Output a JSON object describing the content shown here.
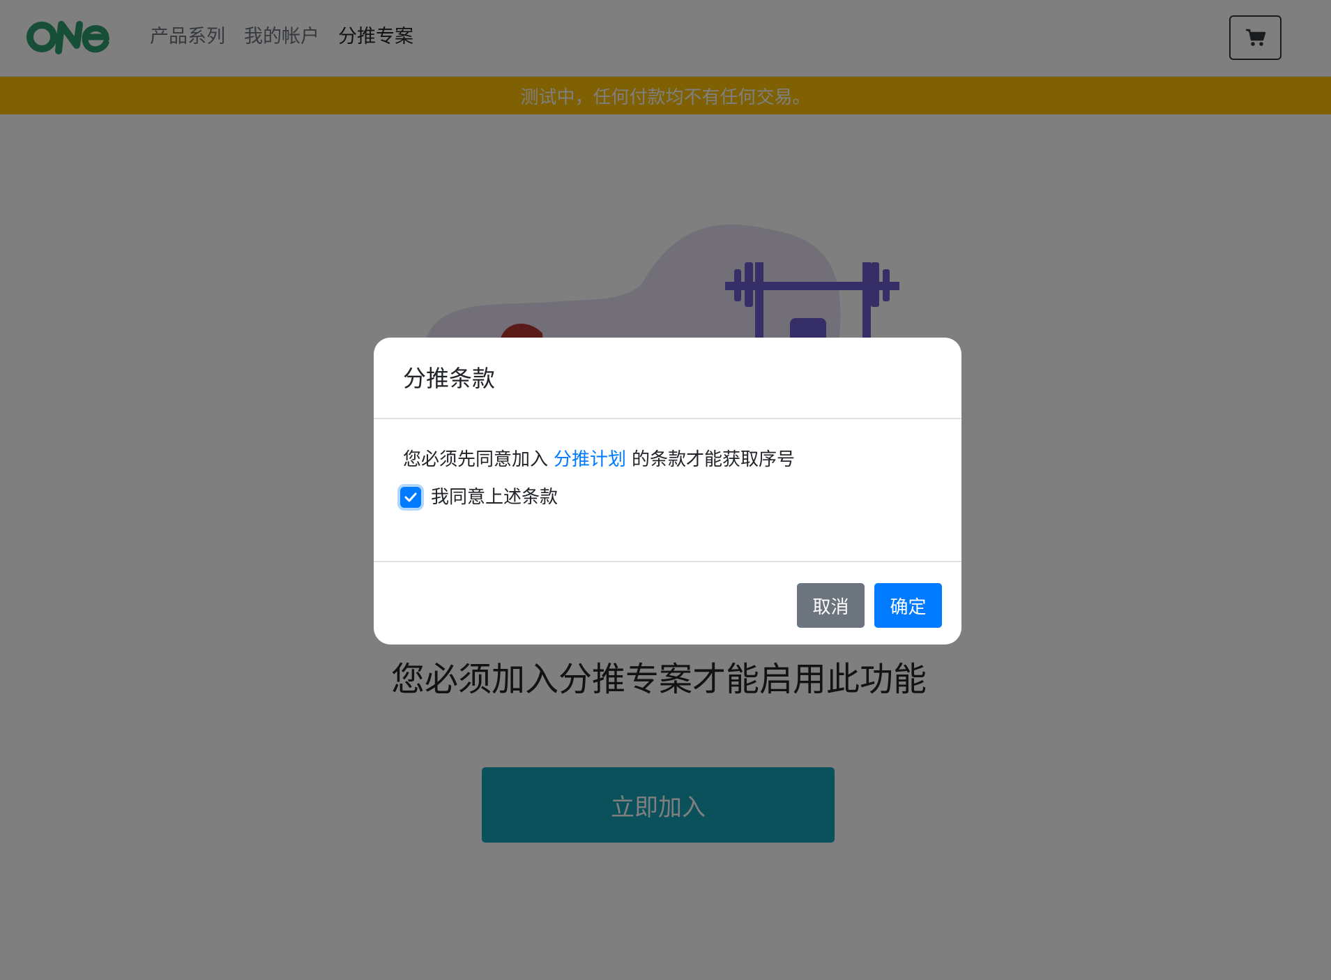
{
  "brand": {
    "name": "ONE",
    "logo_color": "#2e9c6e"
  },
  "nav": {
    "items": [
      {
        "label": "产品系列",
        "active": false
      },
      {
        "label": "我的帐户",
        "active": false
      },
      {
        "label": "分推专案",
        "active": true
      }
    ],
    "cart_icon": "shopping-cart-icon"
  },
  "banner": {
    "text": "测试中，任何付款均不有任何交易。",
    "color": "#ffc107"
  },
  "main": {
    "message": "您必须加入分推专案才能启用此功能",
    "join_label": "立即加入",
    "join_color": "#17a2b8"
  },
  "modal": {
    "title": "分推条款",
    "body_prefix": "您必须先同意加入",
    "body_link": "分推计划",
    "body_suffix": "的条款才能获取序号",
    "checkbox_label": "我同意上述条款",
    "checkbox_checked": true,
    "cancel_label": "取消",
    "confirm_label": "确定"
  },
  "colors": {
    "primary": "#007bff",
    "secondary": "#6c757d"
  }
}
